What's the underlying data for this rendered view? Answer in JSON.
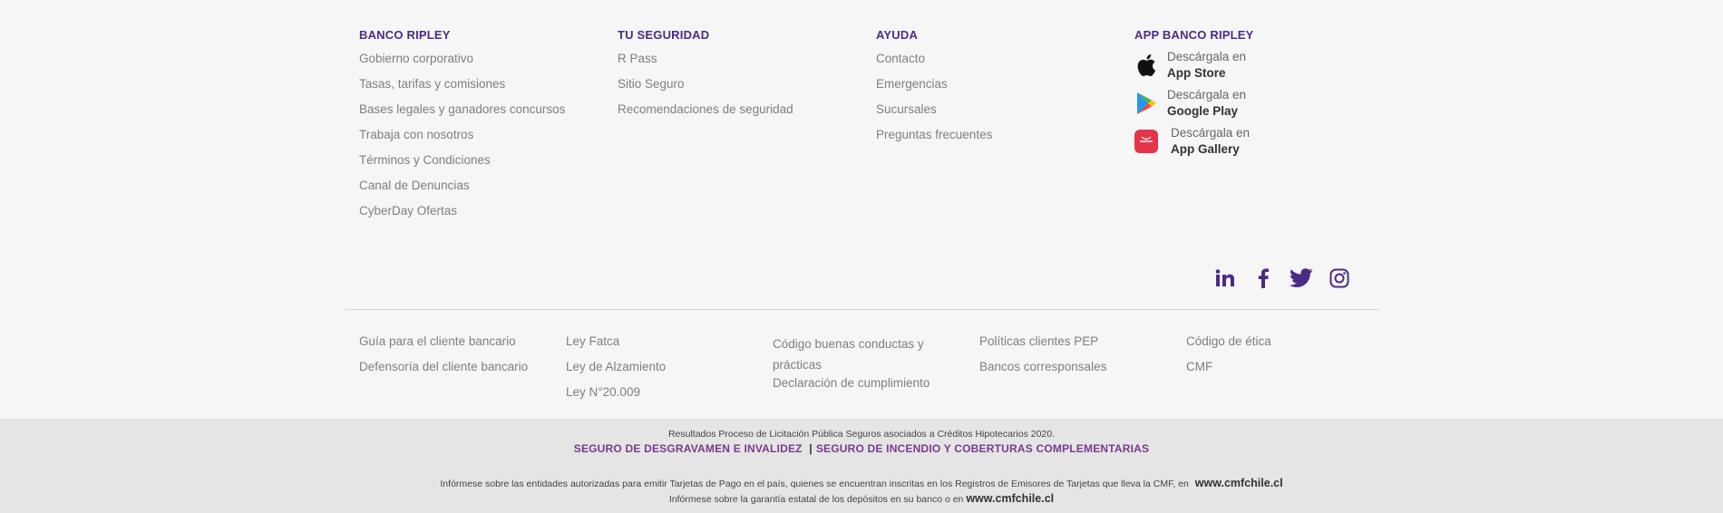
{
  "columns": {
    "banco": {
      "title": "BANCO RIPLEY",
      "items": [
        "Gobierno corporativo",
        "Tasas, tarifas y comisiones",
        "Bases legales y ganadores concursos",
        "Trabaja con nosotros",
        "Términos y Condiciones",
        "Canal de Denuncias",
        "CyberDay Ofertas"
      ]
    },
    "seguridad": {
      "title": "TU SEGURIDAD",
      "items": [
        "R Pass",
        "Sitio Seguro",
        "Recomendaciones de seguridad"
      ]
    },
    "ayuda": {
      "title": "AYUDA",
      "items": [
        "Contacto",
        "Emergencias",
        "Sucursales",
        "Preguntas frecuentes"
      ]
    },
    "app": {
      "title": "APP BANCO RIPLEY",
      "stores": [
        {
          "line1": "Descárgala en",
          "line2": "App Store",
          "icon": "apple-icon"
        },
        {
          "line1": "Descárgala en",
          "line2": "Google Play",
          "icon": "google-play-icon"
        },
        {
          "line1": "Descárgala en",
          "line2": "App Gallery",
          "icon": "huawei-appgallery-icon"
        }
      ]
    }
  },
  "social": [
    "linkedin-icon",
    "facebook-icon",
    "twitter-icon",
    "instagram-icon"
  ],
  "bottom_links": {
    "c1": [
      "Guía para el cliente bancario",
      "Defensoría del cliente bancario"
    ],
    "c2": [
      "Ley Fatca",
      "Ley de Alzamiento",
      "Ley N°20.009"
    ],
    "c3": [
      "Código buenas conductas y prácticas",
      "Declaración de cumplimiento"
    ],
    "c4": [
      "Políticas clientes PEP",
      "Bancos corresponsales"
    ],
    "c5": [
      "Código de ética",
      "CMF"
    ]
  },
  "legal": {
    "line1": "Resultados Proceso de Licitación Pública Seguros asociados a Créditos Hipotecarios 2020.",
    "link1": "SEGURO DE DESGRAVAMEN E INVALIDEZ",
    "separator": "|",
    "link2": "SEGURO DE INCENDIO Y COBERTURAS COMPLEMENTARIAS",
    "line3": "Infórmese sobre las entidades autorizadas para emitir Tarjetas de Pago en el país, quienes se encuentran inscritas en los Registros de Emisores de Tarjetas que lleva la CMF, en",
    "line3_link": "www.cmfchile.cl",
    "line4": "Infórmese sobre la garantía estatal de los depósitos en su banco o en",
    "line4_link": "www.cmfchile.cl"
  },
  "colors": {
    "accent": "#4c2b86",
    "legal_link": "#7a3a8c",
    "legal_bg": "#e4e5e4",
    "bg": "#f6f6f6"
  }
}
